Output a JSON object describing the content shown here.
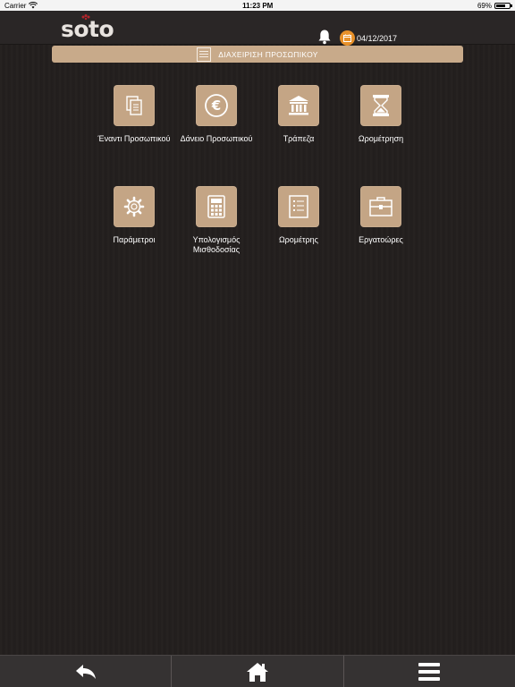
{
  "status_bar": {
    "carrier": "Carrier",
    "time": "11:23 PM",
    "battery": "69%",
    "battery_level": 0.69
  },
  "header": {
    "logo": "soto",
    "date": "04/12/2017",
    "icons": [
      "bell-icon",
      "calendar-icon"
    ],
    "accent_color": "#e8912a"
  },
  "section": {
    "title": "ΔΙΑΧΕΙΡΙΣΗ ΠΡΟΣΩΠΙΚΟΥ",
    "icon": "list-icon"
  },
  "tiles": [
    {
      "label": "Έναντι Προσωπικού",
      "icon": "documents-icon"
    },
    {
      "label": "Δάνειο Προσωπικού",
      "icon": "euro-icon"
    },
    {
      "label": "Τράπεζα",
      "icon": "bank-icon"
    },
    {
      "label": "Ωρομέτρηση",
      "icon": "hourglass-icon"
    },
    {
      "label": "Παράμετροι",
      "icon": "gear-icon"
    },
    {
      "label": "Υπολογισμός Μισθοδοσίας",
      "icon": "calculator-icon"
    },
    {
      "label": "Ωρομέτρης",
      "icon": "checklist-icon"
    },
    {
      "label": "Εργατοώρες",
      "icon": "briefcase-icon"
    }
  ],
  "tile_color": "#c4a585",
  "bottom_nav": [
    "back-icon",
    "home-icon",
    "menu-icon"
  ]
}
